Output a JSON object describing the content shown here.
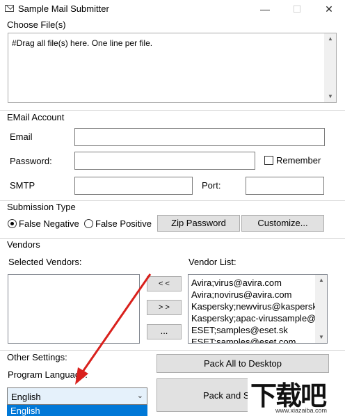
{
  "window": {
    "title": "Sample Mail Submitter",
    "minimize": "—",
    "maximize": "☐",
    "close": "✕"
  },
  "files": {
    "group_label": "Choose File(s)",
    "textarea_value": "#Drag all file(s) here. One line per file."
  },
  "email": {
    "group_label": "EMail Account",
    "email_label": "Email",
    "email_value": "",
    "password_label": "Password:",
    "password_value": "",
    "remember_label": "Remember",
    "smtp_label": "SMTP",
    "smtp_value": "",
    "port_label": "Port:",
    "port_value": ""
  },
  "submission": {
    "group_label": "Submission Type",
    "false_negative": "False Negative",
    "false_positive": "False Positive",
    "zip_password": "Zip Password",
    "customize": "Customize..."
  },
  "vendors": {
    "group_label": "Vendors",
    "selected_label": "Selected Vendors:",
    "list_label": "Vendor List:",
    "move_left": "< <",
    "move_right": "> >",
    "more": "...",
    "vendor_list": [
      "Avira;virus@avira.com",
      "Avira;novirus@avira.com",
      "Kaspersky;newvirus@kaspersky",
      "Kaspersky;apac-virussample@",
      "ESET;samples@eset.sk",
      "ESET;samples@eset.com"
    ]
  },
  "other": {
    "group_label": "Other Settings:",
    "language_label": "Program Language:",
    "language_value": "English",
    "dropdown_item": "English",
    "pack_desktop": "Pack All to Desktop",
    "pack_submit": "Pack and Su"
  },
  "watermark": {
    "text": "下载吧",
    "url": "www.xiazaiba.com"
  },
  "colors": {
    "arrow": "#d9201c",
    "selection": "#0078d7"
  }
}
